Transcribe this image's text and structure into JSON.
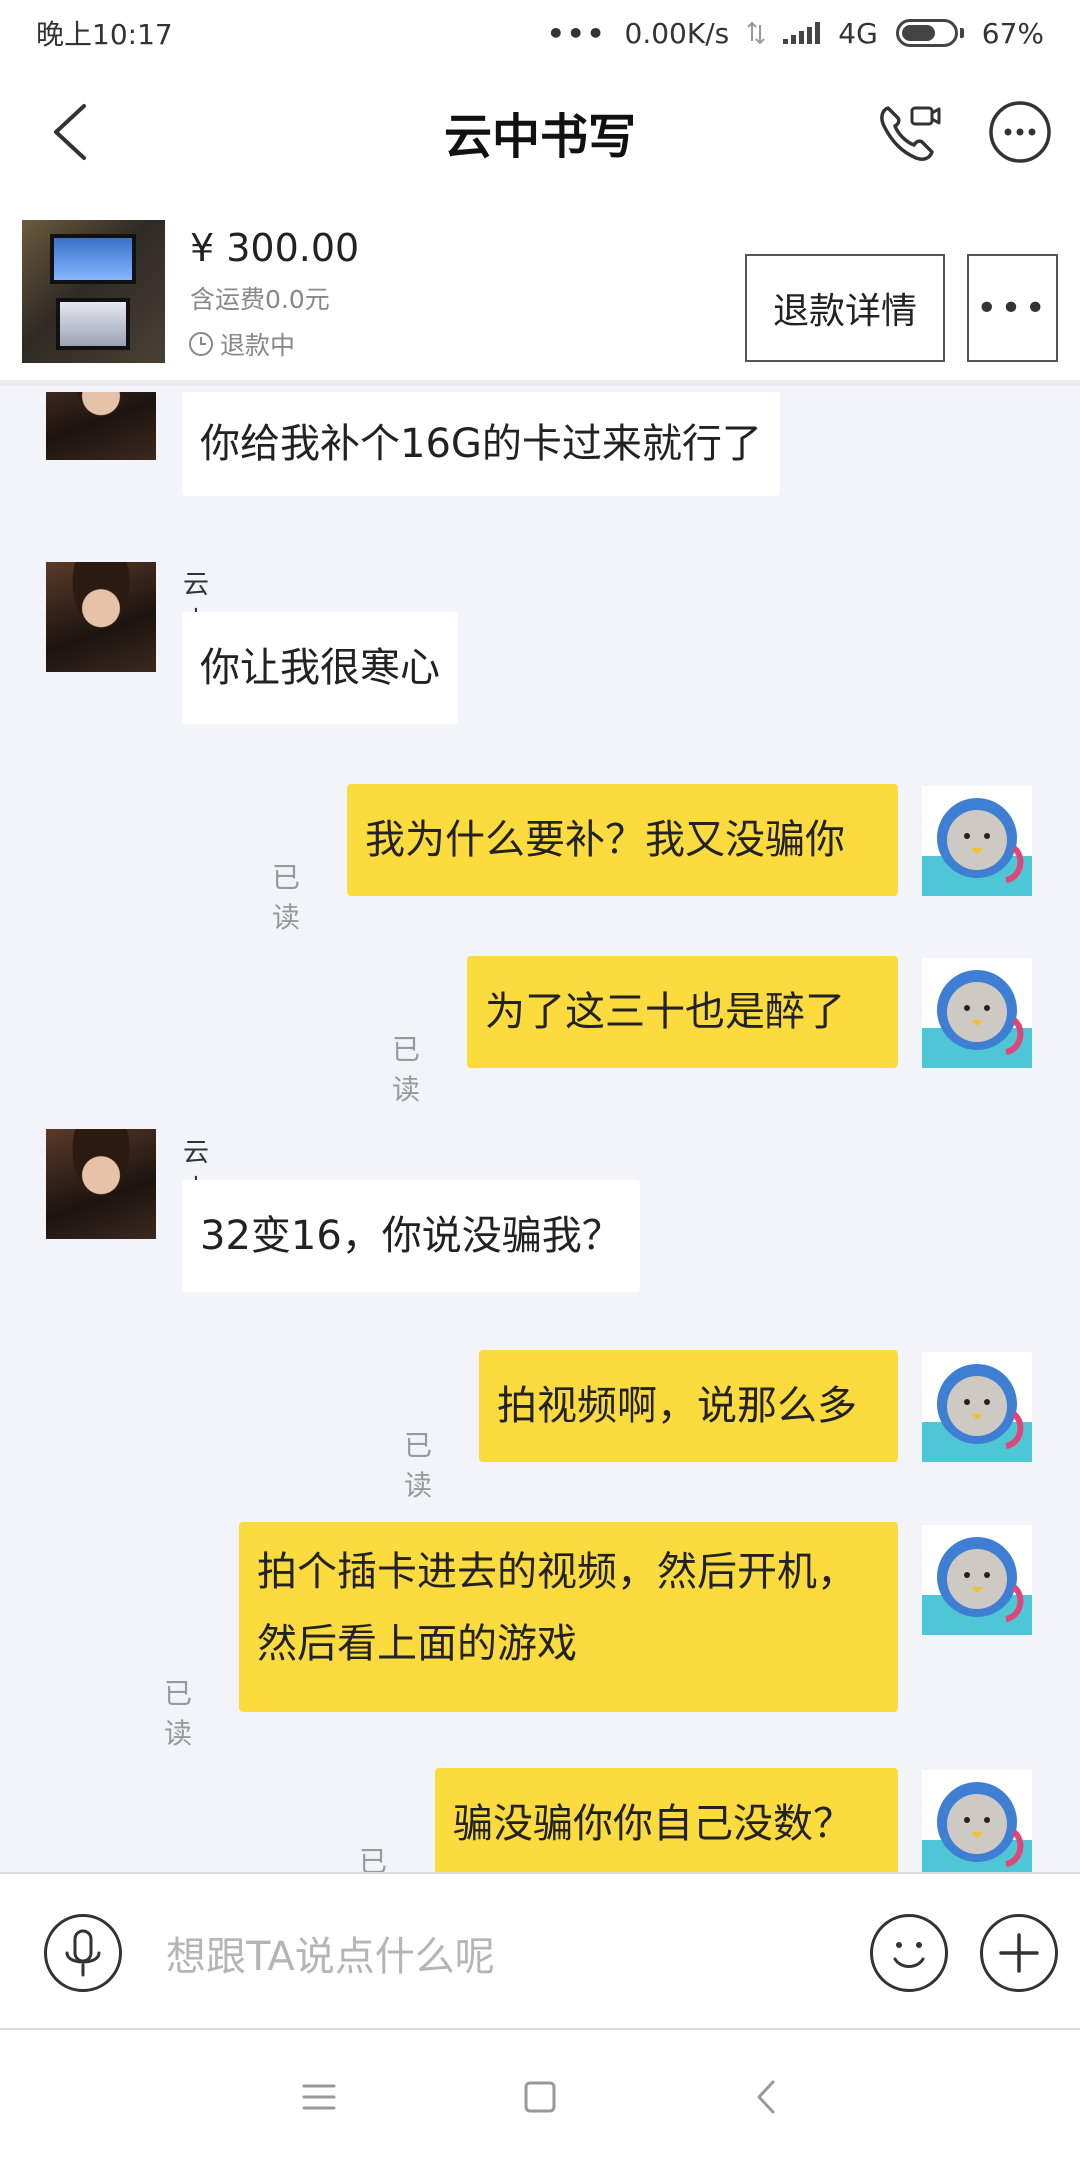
{
  "status_bar": {
    "time": "晚上10:17",
    "network_speed": "0.00K/s",
    "network_type": "4G",
    "battery_percent": "67%",
    "battery_level": 0.67
  },
  "header": {
    "title": "云中书写",
    "icons": [
      "back-icon",
      "video-call-icon",
      "more-icon"
    ]
  },
  "order": {
    "price": "¥ 300.00",
    "shipping": "含运费0.0元",
    "status": "退款中",
    "refund_detail_label": "退款详情",
    "more_label": "•••"
  },
  "messages": [
    {
      "side": "in",
      "text": "你给我补个16G的卡过来就行了"
    },
    {
      "side": "in",
      "sender": "云中书写",
      "text": "你让我很寒心"
    },
    {
      "side": "out",
      "read": "已读",
      "text": "我为什么要补？我又没骗你"
    },
    {
      "side": "out",
      "read": "已读",
      "text": "为了这三十也是醉了"
    },
    {
      "side": "in",
      "sender": "云中书写",
      "text": "32变16，你说没骗我？"
    },
    {
      "side": "out",
      "read": "已读",
      "text": "拍视频啊，说那么多"
    },
    {
      "side": "out",
      "read": "已读",
      "text": "拍个插卡进去的视频，然后开机，然后看上面的游戏"
    },
    {
      "side": "out",
      "read": "已读",
      "text": "骗没骗你你自己没数？"
    }
  ],
  "input": {
    "placeholder": "想跟TA说点什么呢",
    "icons": [
      "microphone-icon",
      "emoji-icon",
      "plus-icon"
    ]
  },
  "nav": {
    "icons": [
      "menu-icon",
      "home-icon",
      "back-nav-icon"
    ]
  },
  "colors": {
    "outgoing_bubble": "#fcdb3e",
    "incoming_bubble": "#ffffff",
    "chat_background": "#f3f4fa",
    "read_tag": "#999999"
  }
}
